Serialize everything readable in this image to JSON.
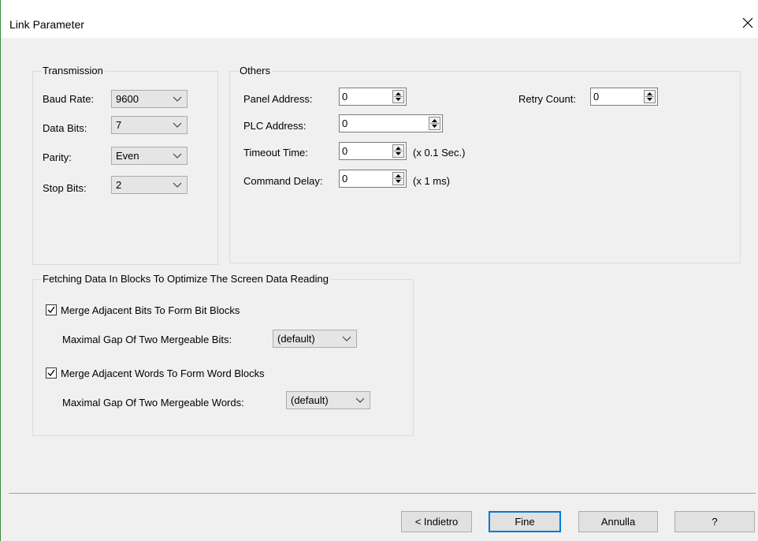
{
  "window": {
    "title": "Link Parameter",
    "close_glyph": "×"
  },
  "transmission": {
    "legend": "Transmission",
    "baud_rate": {
      "label": "Baud Rate:",
      "value": "9600"
    },
    "data_bits": {
      "label": "Data Bits:",
      "value": "7"
    },
    "parity": {
      "label": "Parity:",
      "value": "Even"
    },
    "stop_bits": {
      "label": "Stop Bits:",
      "value": "2"
    }
  },
  "others": {
    "legend": "Others",
    "panel_address": {
      "label": "Panel Address:",
      "value": "0"
    },
    "plc_address": {
      "label": "PLC Address:",
      "value": "0"
    },
    "timeout_time": {
      "label": "Timeout Time:",
      "value": "0",
      "unit": "(x 0.1 Sec.)"
    },
    "command_delay": {
      "label": "Command Delay:",
      "value": "0",
      "unit": "(x 1 ms)"
    },
    "retry_count": {
      "label": "Retry Count:",
      "value": "0"
    }
  },
  "fetching": {
    "legend": "Fetching Data In Blocks To Optimize The Screen Data Reading",
    "merge_bits": {
      "label": "Merge Adjacent Bits To Form Bit Blocks",
      "checked": true
    },
    "max_gap_bits": {
      "label": "Maximal Gap Of Two Mergeable Bits:",
      "value": "(default)"
    },
    "merge_words": {
      "label": "Merge Adjacent Words To Form Word Blocks",
      "checked": true
    },
    "max_gap_words": {
      "label": "Maximal Gap Of Two Mergeable Words:",
      "value": "(default)"
    }
  },
  "buttons": {
    "back": "< Indietro",
    "finish": "Fine",
    "cancel": "Annulla",
    "help": "?"
  },
  "colors": {
    "accent": "#0078d7",
    "window_edge": "#3c8c3c"
  }
}
